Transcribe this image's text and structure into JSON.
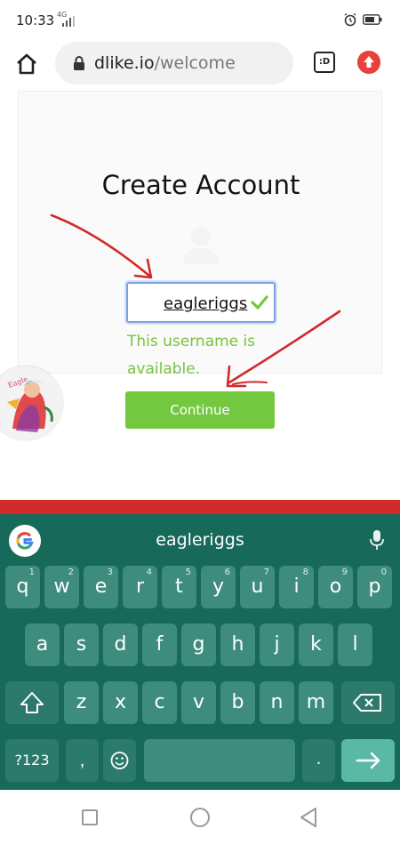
{
  "status_bar": {
    "time": "10:33",
    "network": "4G"
  },
  "browser": {
    "url_host": "dlike.io",
    "url_path": "/welcome",
    "tab_label": ":D"
  },
  "page": {
    "title": "Create Account",
    "username_value": "eagleriggs",
    "availability_message": "This username is available.",
    "continue_label": "Continue"
  },
  "colors": {
    "accent_green": "#74c83f",
    "message_green": "#79c23f",
    "keyboard_bg": "#17695a",
    "annotation_red": "#d12a2a"
  },
  "keyboard": {
    "suggestion": "eagleriggs",
    "row1": [
      {
        "key": "q",
        "hint": "1"
      },
      {
        "key": "w",
        "hint": "2"
      },
      {
        "key": "e",
        "hint": "3"
      },
      {
        "key": "r",
        "hint": "4"
      },
      {
        "key": "t",
        "hint": "5"
      },
      {
        "key": "y",
        "hint": "6"
      },
      {
        "key": "u",
        "hint": "7"
      },
      {
        "key": "i",
        "hint": "8"
      },
      {
        "key": "o",
        "hint": "9"
      },
      {
        "key": "p",
        "hint": "0"
      }
    ],
    "row2": [
      "a",
      "s",
      "d",
      "f",
      "g",
      "h",
      "j",
      "k",
      "l"
    ],
    "row3": [
      "z",
      "x",
      "c",
      "v",
      "b",
      "n",
      "m"
    ],
    "symbols_label": "?123",
    "comma_label": ",",
    "period_label": "."
  },
  "icons": {
    "home": "home-icon",
    "lock": "lock-icon",
    "upgrade": "upgrade-arrow-icon",
    "mic": "mic-icon",
    "shift": "shift-icon",
    "backspace": "backspace-icon",
    "enter": "enter-arrow-icon",
    "emoji": "emoji-icon"
  }
}
